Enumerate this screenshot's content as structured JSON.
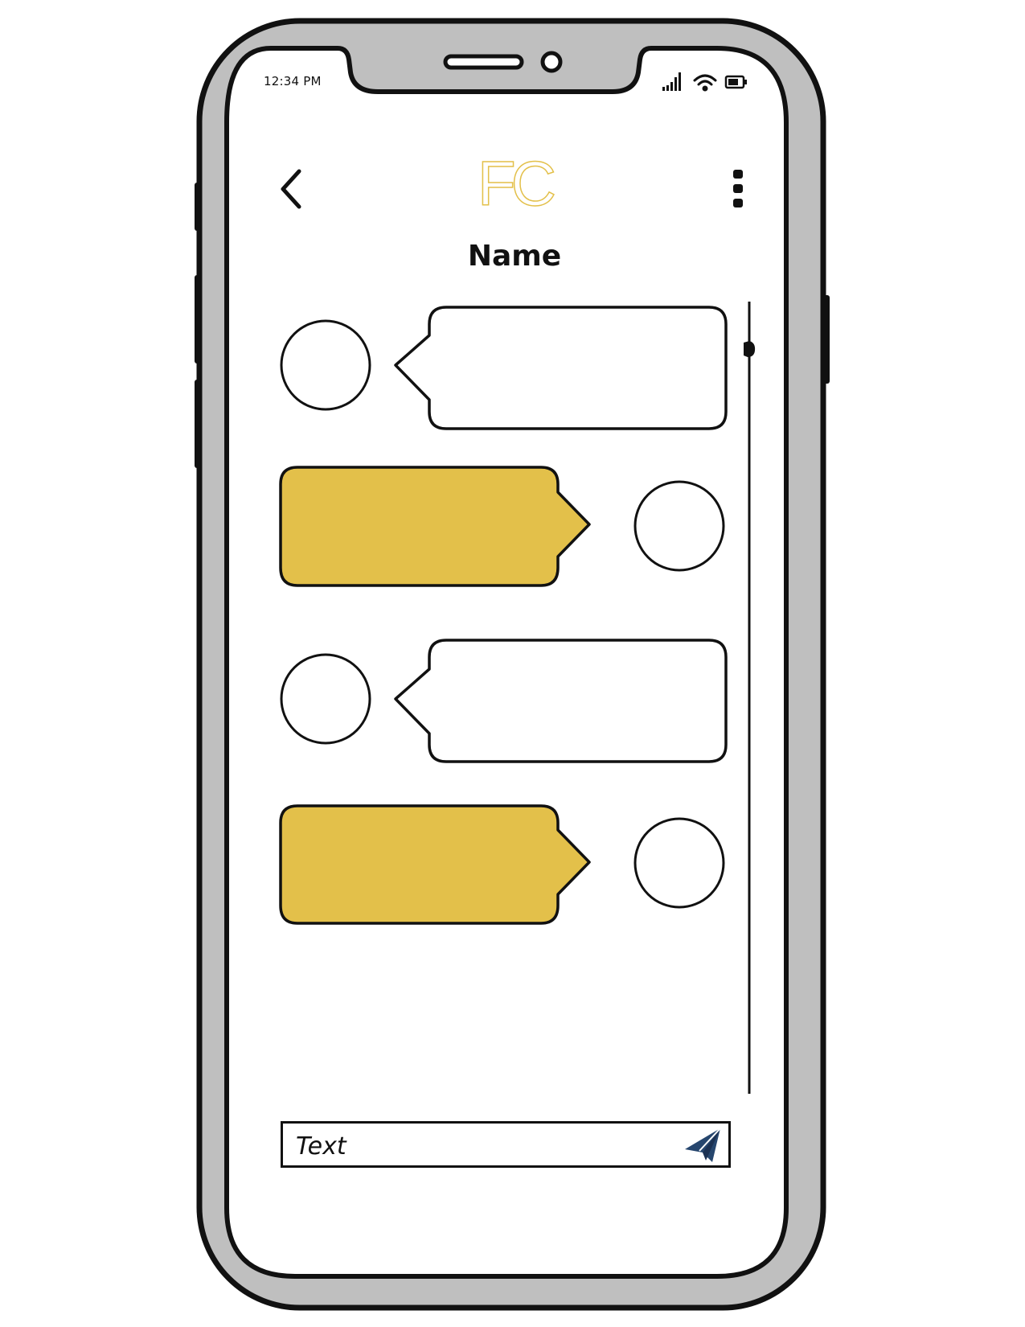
{
  "status_bar": {
    "time": "12:34 PM",
    "icons": [
      "signal-icon",
      "wifi-icon",
      "battery-icon"
    ]
  },
  "header": {
    "back_icon": "chevron-left-icon",
    "logo_text": "FC",
    "title": "Name",
    "menu_icon": "more-vertical-icon"
  },
  "messages": [
    {
      "side": "incoming",
      "text": ""
    },
    {
      "side": "outgoing",
      "text": ""
    },
    {
      "side": "incoming",
      "text": ""
    },
    {
      "side": "outgoing",
      "text": ""
    }
  ],
  "composer": {
    "placeholder": "Text",
    "send_icon": "paper-plane-icon"
  },
  "colors": {
    "accent": "#e3c04a",
    "frame": "#bfbfbf",
    "ink": "#111111",
    "send_icon": "#26466e"
  }
}
